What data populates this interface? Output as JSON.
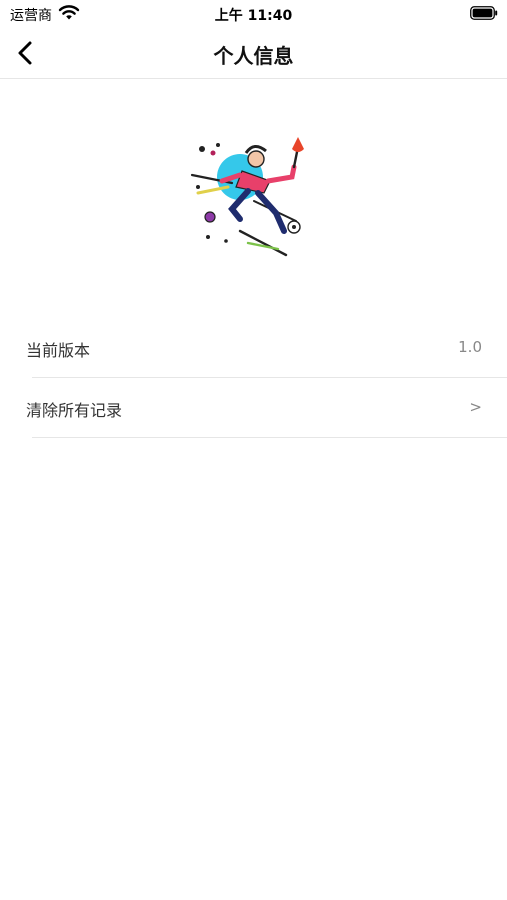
{
  "status_bar": {
    "carrier": "运营商",
    "time": "上午 11:40"
  },
  "nav": {
    "title": "个人信息"
  },
  "settings": [
    {
      "label": "当前版本",
      "value": "1.0"
    },
    {
      "label": "清除所有记录",
      "value": ">"
    }
  ]
}
